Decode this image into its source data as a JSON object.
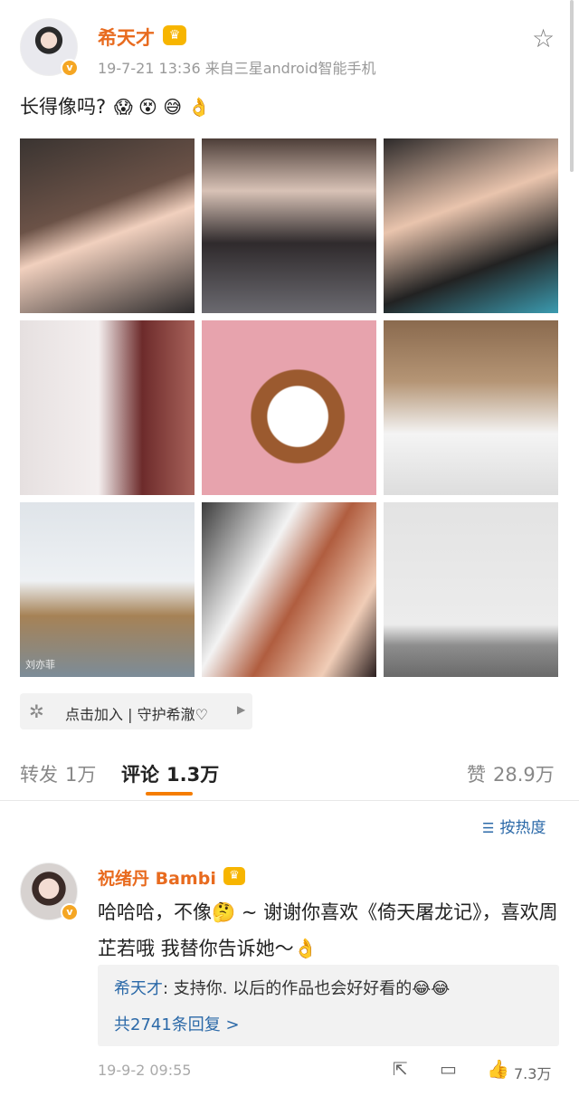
{
  "post": {
    "author": "希天才",
    "meta": "19-7-21 13:36  来自三星android智能手机",
    "text": "长得像吗?",
    "emojis": "😱 😵 😅 👌",
    "tile_caption": "刘亦菲"
  },
  "topic": {
    "label": "点击加入 | 守护希澈♡"
  },
  "stats": {
    "repost_label": "转发",
    "repost_count": "1万",
    "comment_label": "评论",
    "comment_count": "1.3万",
    "like_label": "赞",
    "like_count": "28.9万"
  },
  "sort": {
    "label": "按热度"
  },
  "comment": {
    "author": "祝绪丹 Bambi",
    "text": "哈哈哈，不像🤔 ~ 谢谢你喜欢《倚天屠龙记》，喜欢周芷若哦 我替你告诉她～👌",
    "reply_author": "希天才",
    "reply_text": ": 支持你. 以后的作品也会好好看的😂😂",
    "reply_more": "共2741条回复 >",
    "time": "19-9-2 09:55",
    "likes": "7.3万"
  },
  "colors": {
    "accent_orange": "#f57d00",
    "name_orange": "#e86b1f",
    "link_blue": "#2b69a8"
  }
}
